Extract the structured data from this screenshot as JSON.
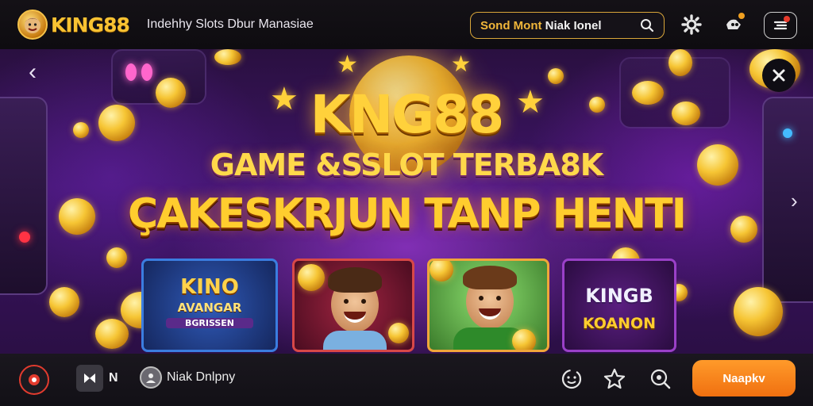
{
  "header": {
    "logo_text": "KING88",
    "tagline": "Indehhy Slots Dbur Manasiae",
    "search": {
      "text_gold": "Sond Mont",
      "text_white": "Niak Ionel"
    }
  },
  "hero": {
    "brand": "KNG88",
    "headline1": "GAME &SSLOT TERBA8K",
    "headline2": "ÇAKESKRJUN TANP HENTI",
    "cards": [
      {
        "title_top": "KINO",
        "title_mid": "AVANGAR",
        "title_bottom": "BGRISSEN"
      },
      {
        "label": ""
      },
      {
        "label": ""
      },
      {
        "title_top": "KINGB",
        "title_bottom": "KOANON"
      }
    ]
  },
  "bottombar": {
    "square_label": "M",
    "n_label": "N",
    "text": "Niak Dnlpny",
    "cta_label": "Naapkv"
  },
  "colors": {
    "accent_gold": "#f8c232",
    "cta_orange": "#f58a1f",
    "brand_purple": "#3d1466"
  }
}
